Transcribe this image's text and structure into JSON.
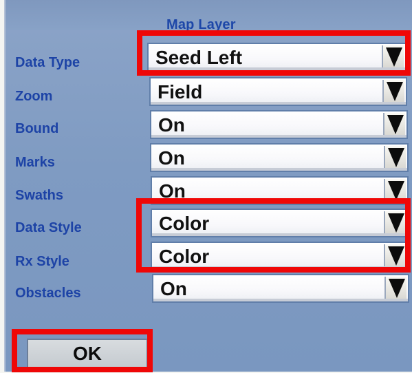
{
  "dialog": {
    "title": "Map Layer",
    "fields": [
      {
        "label": "Data Type",
        "value": "Seed Left",
        "icon": "chevron-down-icon"
      },
      {
        "label": "Zoom",
        "value": "Field",
        "icon": "chevron-down-icon"
      },
      {
        "label": "Bound",
        "value": "On",
        "icon": "chevron-down-icon"
      },
      {
        "label": "Marks",
        "value": "On",
        "icon": "chevron-down-icon"
      },
      {
        "label": "Swaths",
        "value": "On",
        "icon": "chevron-down-icon"
      },
      {
        "label": "Data Style",
        "value": "Color",
        "icon": "chevron-down-icon"
      },
      {
        "label": "Rx Style",
        "value": "Color",
        "icon": "chevron-down-icon"
      },
      {
        "label": "Obstacles",
        "value": "On",
        "icon": "chevron-down-icon"
      }
    ],
    "ok_label": "OK"
  },
  "colors": {
    "panel": "#7f9bc2",
    "label": "#1d43a6",
    "highlight": "#ef0707"
  }
}
